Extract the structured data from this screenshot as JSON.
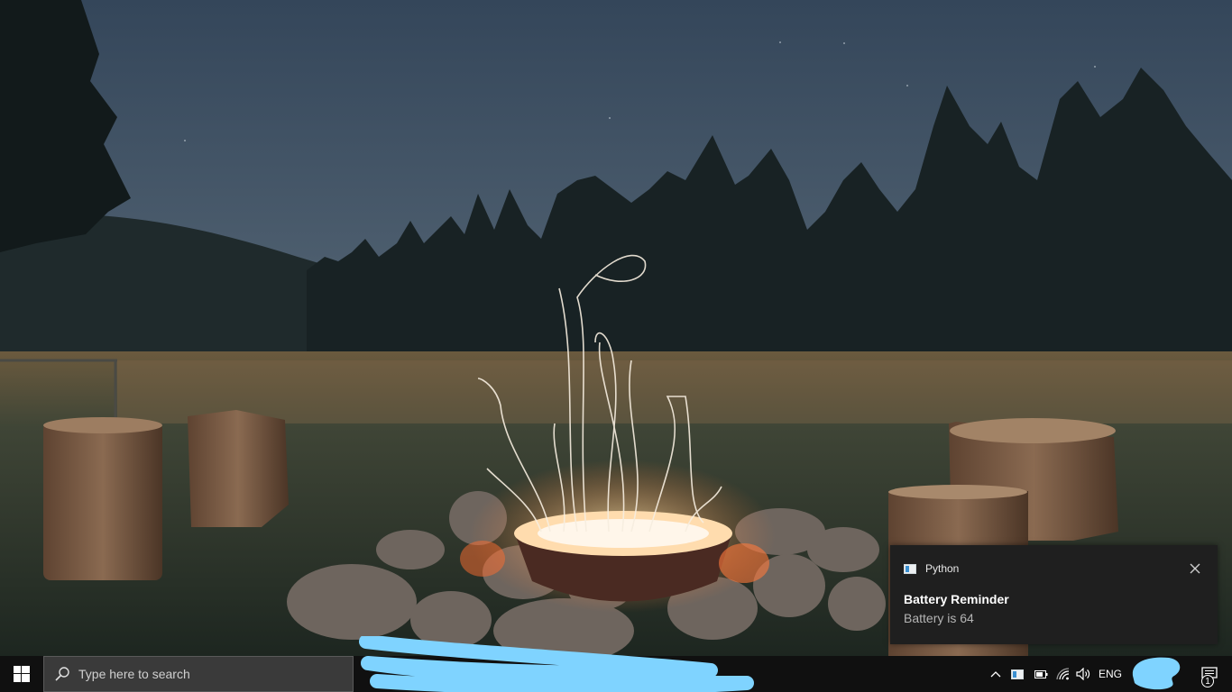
{
  "toast": {
    "app_name": "Python",
    "title": "Battery Reminder",
    "body": "Battery is 64",
    "app_icon": "python-app-icon",
    "close_icon": "close-icon"
  },
  "taskbar": {
    "start_icon": "windows-logo-icon",
    "search_placeholder": "Type here to search",
    "search_icon": "search-icon",
    "tray": {
      "chevron_icon": "chevron-up-icon",
      "app_icon": "tray-app-icon",
      "battery_icon": "battery-icon",
      "network_icon": "wifi-icon",
      "volume_icon": "volume-icon",
      "language": "ENG",
      "action_center_icon": "action-center-icon",
      "notification_count": "1"
    }
  },
  "colors": {
    "taskbar_bg": "#101010",
    "search_bg": "#3a3a3a",
    "toast_bg": "#1f1f1f",
    "redaction": "#7fd3ff"
  }
}
